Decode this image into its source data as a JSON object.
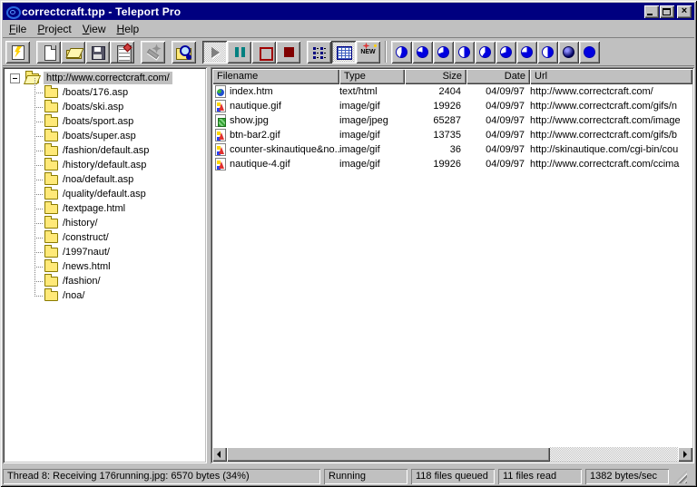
{
  "window": {
    "title": "correctcraft.tpp - Teleport Pro"
  },
  "menu": {
    "items": [
      {
        "label": "File",
        "underline": 0
      },
      {
        "label": "Project",
        "underline": 0
      },
      {
        "label": "View",
        "underline": 0
      },
      {
        "label": "Help",
        "underline": 0
      }
    ]
  },
  "toolbar": {
    "groups": [
      {
        "buttons": [
          {
            "name": "new-project-wizard",
            "icon": "wizard"
          }
        ]
      },
      {
        "buttons": [
          {
            "name": "new-project",
            "icon": "new"
          },
          {
            "name": "open-project",
            "icon": "open"
          },
          {
            "name": "save-project",
            "icon": "save"
          },
          {
            "name": "project-properties",
            "icon": "props"
          }
        ]
      },
      {
        "buttons": [
          {
            "name": "retrieve-wizard",
            "icon": "wand",
            "state": "disabled"
          }
        ]
      },
      {
        "buttons": [
          {
            "name": "browse-file",
            "icon": "browse"
          }
        ]
      },
      {
        "buttons": [
          {
            "name": "start-project",
            "icon": "play",
            "state": "pressed-disabled"
          },
          {
            "name": "pause-project",
            "icon": "pause"
          },
          {
            "name": "stop-project",
            "icon": "stop"
          },
          {
            "name": "abort-project",
            "icon": "abort"
          }
        ]
      },
      {
        "buttons": [
          {
            "name": "list-view",
            "icon": "listview"
          },
          {
            "name": "details-view",
            "icon": "details",
            "state": "pressed"
          },
          {
            "name": "highlight-new-files",
            "icon": "newtag",
            "label": "NEW"
          }
        ]
      }
    ],
    "threads": [
      {
        "name": "thread-1",
        "kind": "pie",
        "from": 0,
        "fill": 55
      },
      {
        "name": "thread-2",
        "kind": "pie",
        "from": 0,
        "fill": 78
      },
      {
        "name": "thread-3",
        "kind": "pie",
        "from": 0,
        "fill": 70
      },
      {
        "name": "thread-4",
        "kind": "pie",
        "from": 0,
        "fill": 50
      },
      {
        "name": "thread-5",
        "kind": "pie",
        "from": 0,
        "fill": 60
      },
      {
        "name": "thread-6",
        "kind": "pie",
        "from": 0,
        "fill": 70
      },
      {
        "name": "thread-7",
        "kind": "pie",
        "from": 0,
        "fill": 75
      },
      {
        "name": "thread-8",
        "kind": "pie",
        "from": 0,
        "fill": 50
      },
      {
        "name": "thread-9",
        "kind": "sphere"
      },
      {
        "name": "thread-10",
        "kind": "full"
      }
    ]
  },
  "tree": {
    "root": {
      "label": "http://www.correctcraft.com/",
      "selected": true,
      "expanded": true
    },
    "items": [
      "/boats/176.asp",
      "/boats/ski.asp",
      "/boats/sport.asp",
      "/boats/super.asp",
      "/fashion/default.asp",
      "/history/default.asp",
      "/noa/default.asp",
      "/quality/default.asp",
      "/textpage.html",
      "/history/",
      "/construct/",
      "/1997naut/",
      "/news.html",
      "/fashion/",
      "/noa/"
    ]
  },
  "filelist": {
    "columns": [
      {
        "label": "Filename",
        "width": 140,
        "align": "left"
      },
      {
        "label": "Type",
        "width": 72,
        "align": "left"
      },
      {
        "label": "Size",
        "width": 68,
        "align": "right"
      },
      {
        "label": "Date",
        "width": 70,
        "align": "right"
      },
      {
        "label": "Url",
        "width": 0,
        "align": "left"
      }
    ],
    "rows": [
      {
        "icon": "html",
        "filename": "index.htm",
        "type": "text/html",
        "size": "2404",
        "date": "04/09/97",
        "url": "http://www.correctcraft.com/"
      },
      {
        "icon": "gif",
        "filename": "nautique.gif",
        "type": "image/gif",
        "size": "19926",
        "date": "04/09/97",
        "url": "http://www.correctcraft.com/gifs/n"
      },
      {
        "icon": "jpeg",
        "filename": "show.jpg",
        "type": "image/jpeg",
        "size": "65287",
        "date": "04/09/97",
        "url": "http://www.correctcraft.com/image"
      },
      {
        "icon": "gif",
        "filename": "btn-bar2.gif",
        "type": "image/gif",
        "size": "13735",
        "date": "04/09/97",
        "url": "http://www.correctcraft.com/gifs/b"
      },
      {
        "icon": "gif",
        "filename": "counter-skinautique&no...",
        "type": "image/gif",
        "size": "36",
        "date": "04/09/97",
        "url": "http://skinautique.com/cgi-bin/cou"
      },
      {
        "icon": "gif",
        "filename": "nautique-4.gif",
        "type": "image/gif",
        "size": "19926",
        "date": "04/09/97",
        "url": "http://www.correctcraft.com/ccima"
      }
    ]
  },
  "statusbar": {
    "message": "Thread 8: Receiving 176running.jpg: 6570 bytes (34%)",
    "panels": [
      "Running",
      "118 files queued",
      "11 files read",
      "1382 bytes/sec"
    ]
  },
  "colors": {
    "titlebar": "#000080",
    "thread": "#0000e0",
    "window_face": "#c0c0c0",
    "selection_inactive": "#c0c0c0"
  }
}
